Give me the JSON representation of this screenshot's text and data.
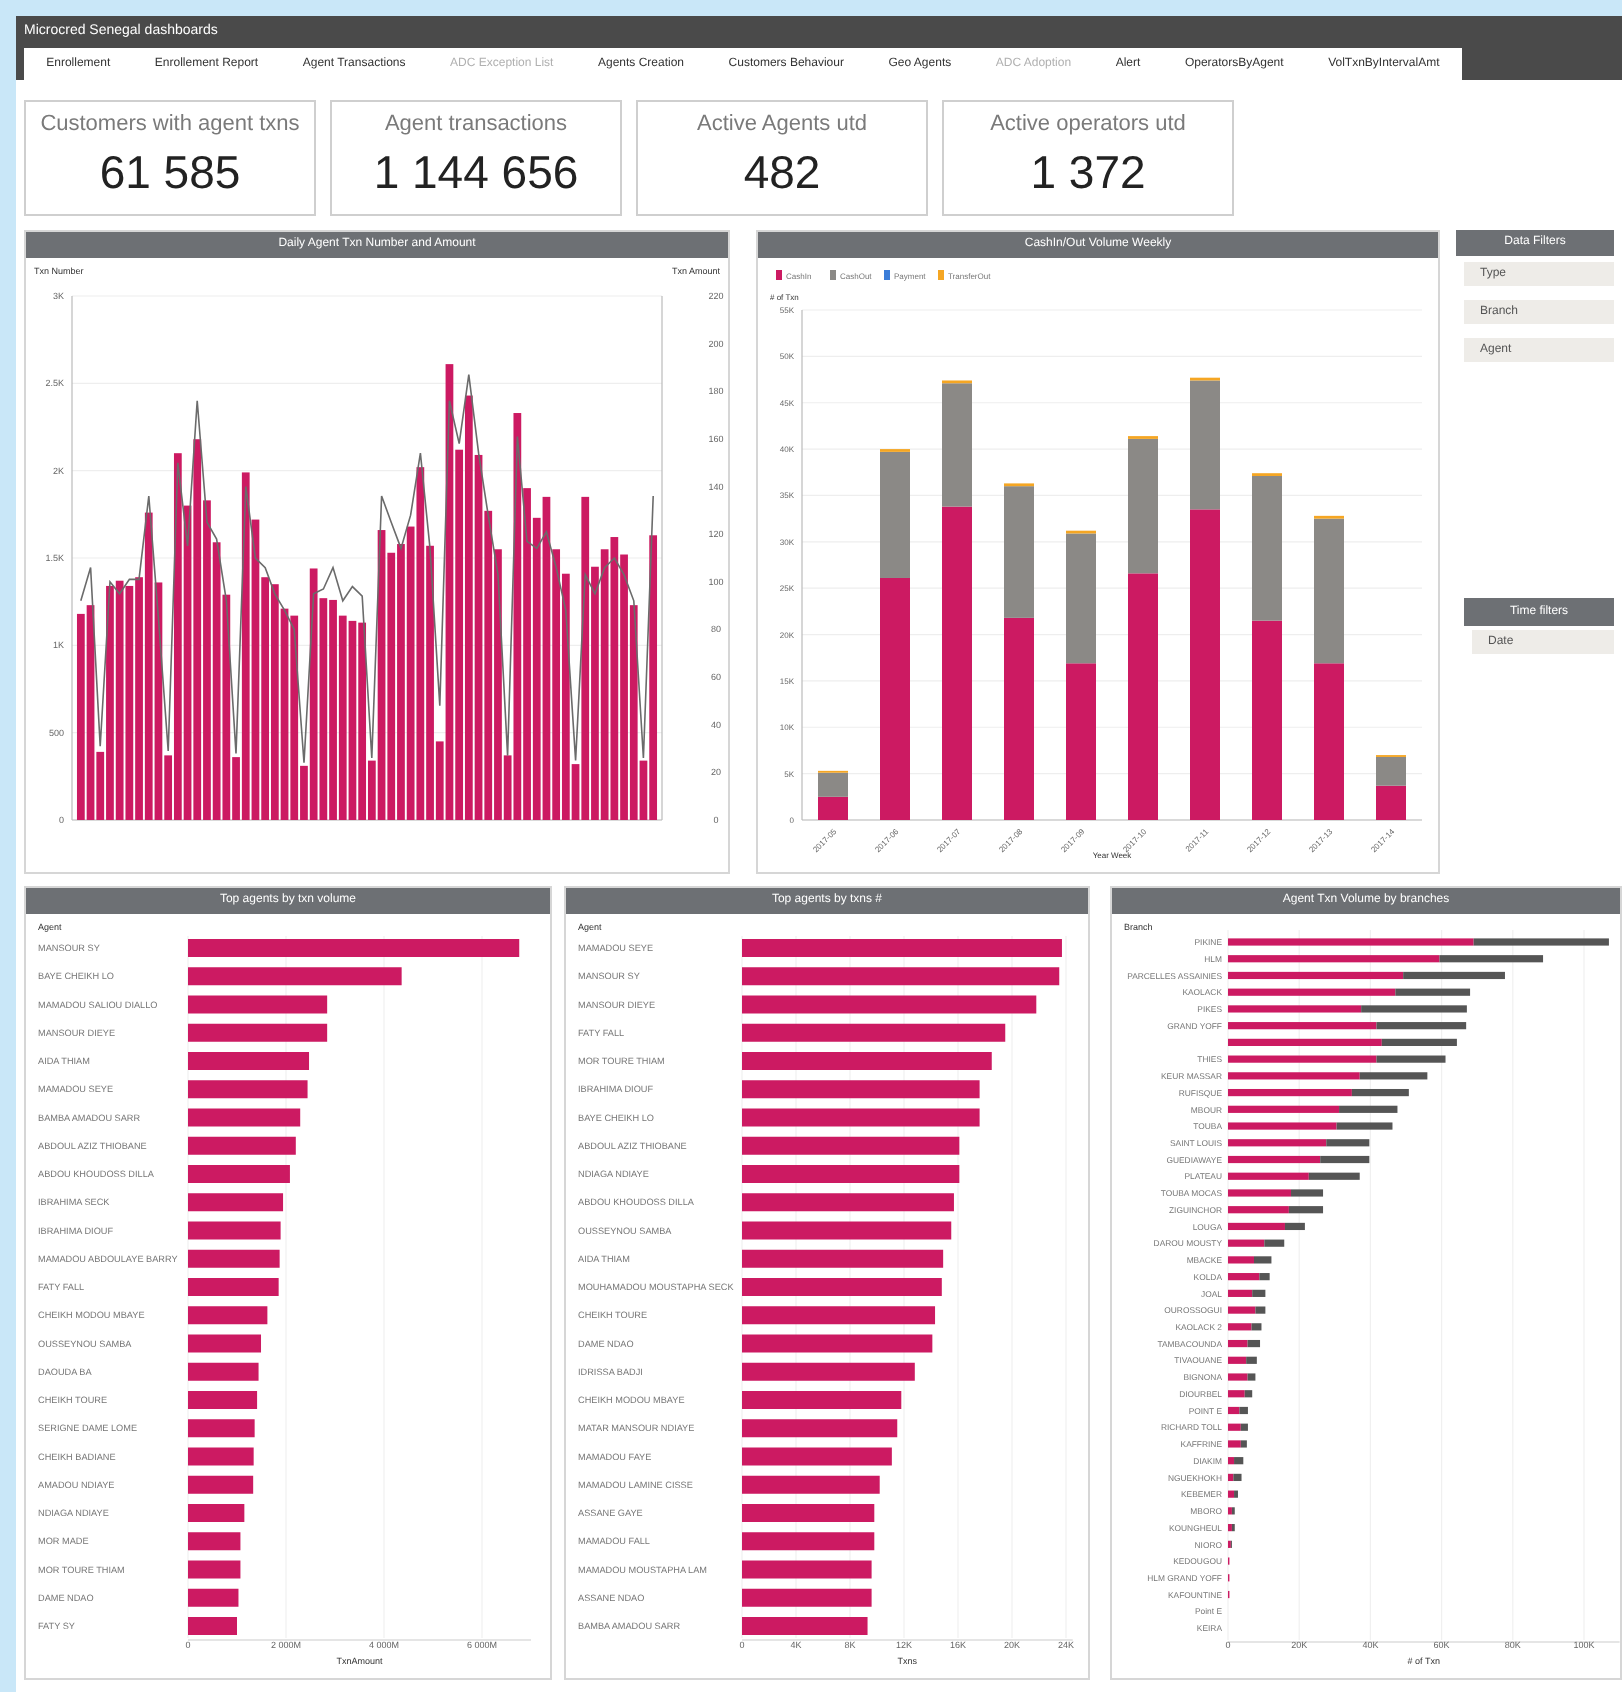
{
  "header": {
    "title": "Microcred Senegal dashboards"
  },
  "tabs": [
    {
      "label": "Enrollement",
      "disabled": false
    },
    {
      "label": "Enrollement Report",
      "disabled": false
    },
    {
      "label": "Agent Transactions",
      "disabled": false
    },
    {
      "label": "ADC Exception List",
      "disabled": true
    },
    {
      "label": "Agents Creation",
      "disabled": false
    },
    {
      "label": "Customers Behaviour",
      "disabled": false
    },
    {
      "label": "Geo Agents",
      "disabled": false
    },
    {
      "label": "ADC Adoption",
      "disabled": true
    },
    {
      "label": "Alert",
      "disabled": false
    },
    {
      "label": "OperatorsByAgent",
      "disabled": false
    },
    {
      "label": "VolTxnByIntervalAmt",
      "disabled": false
    }
  ],
  "kpis": [
    {
      "label": "Customers with agent txns",
      "value": "61 585"
    },
    {
      "label": "Agent transactions",
      "value": "1 144 656"
    },
    {
      "label": "Active Agents utd",
      "value": "482"
    },
    {
      "label": "Active operators utd",
      "value": "1 372"
    }
  ],
  "daily_panel": {
    "title": "Daily Agent Txn Number and Amount",
    "chart_data": {
      "type": "bar",
      "grid": true,
      "ylabel": "Txn Number",
      "y2label": "Txn Amount",
      "ylim": [
        0,
        3000
      ],
      "y2lim": [
        0,
        220
      ],
      "yticks": [
        {
          "value": 0,
          "label": "0"
        },
        {
          "value": 500,
          "label": "500"
        },
        {
          "value": 1000,
          "label": "1K"
        },
        {
          "value": 1500,
          "label": "1.5K"
        },
        {
          "value": 2000,
          "label": "2K"
        },
        {
          "value": 2500,
          "label": "2.5K"
        },
        {
          "value": 3000,
          "label": "3K"
        }
      ],
      "y2ticks": [
        0,
        20,
        40,
        60,
        80,
        100,
        120,
        140,
        160,
        180,
        200,
        220
      ],
      "series": [
        {
          "type": "bar",
          "color": "#cc1a62",
          "values": [
            1180,
            1230,
            390,
            1340,
            1370,
            1340,
            1390,
            1760,
            1360,
            370,
            2100,
            1800,
            2180,
            1830,
            1590,
            1290,
            360,
            1990,
            1720,
            1390,
            1350,
            1210,
            1170,
            310,
            1440,
            1270,
            1260,
            1170,
            1140,
            1130,
            340,
            1660,
            1530,
            1580,
            1680,
            2020,
            1570,
            450,
            2610,
            2120,
            2430,
            2090,
            1770,
            1550,
            370,
            2330,
            1900,
            1730,
            1850,
            1550,
            1410,
            320,
            1850,
            1450,
            1550,
            1620,
            1520,
            1230,
            340,
            1630
          ]
        },
        {
          "type": "line",
          "axis": "y2",
          "color": "#6b6b6b",
          "values": [
            92,
            106,
            31,
            100,
            95,
            101,
            101,
            136,
            85,
            29,
            150,
            115,
            176,
            125,
            118,
            92,
            28,
            140,
            110,
            106,
            95,
            88,
            80,
            24,
            95,
            97,
            106,
            92,
            98,
            94,
            26,
            136,
            125,
            114,
            128,
            154,
            114,
            48,
            176,
            158,
            187,
            154,
            128,
            103,
            27,
            161,
            117,
            114,
            121,
            106,
            88,
            25,
            103,
            95,
            106,
            110,
            103,
            92,
            26,
            136
          ]
        }
      ]
    }
  },
  "weekly_panel": {
    "title": "CashIn/Out Volume Weekly",
    "chart_data": {
      "type": "bar",
      "stacked": true,
      "grid": true,
      "legend": true,
      "ylim": [
        0,
        55000
      ],
      "xlabel": "Year Week",
      "ylabel": "# of Txn",
      "categories": [
        "2017-05",
        "2017-06",
        "2017-07",
        "2017-08",
        "2017-09",
        "2017-10",
        "2017-11",
        "2017-12",
        "2017-13",
        "2017-14"
      ],
      "yticks": [
        {
          "value": 0,
          "label": "0"
        },
        {
          "value": 5000,
          "label": "5K"
        },
        {
          "value": 10000,
          "label": "10K"
        },
        {
          "value": 15000,
          "label": "15K"
        },
        {
          "value": 20000,
          "label": "20K"
        },
        {
          "value": 25000,
          "label": "25K"
        },
        {
          "value": 30000,
          "label": "30K"
        },
        {
          "value": 35000,
          "label": "35K"
        },
        {
          "value": 40000,
          "label": "40K"
        },
        {
          "value": 45000,
          "label": "45K"
        },
        {
          "value": 50000,
          "label": "50K"
        },
        {
          "value": 55000,
          "label": "55K"
        }
      ],
      "series": [
        {
          "name": "CashIn",
          "color": "#cc1a62",
          "values": [
            2500,
            26100,
            33800,
            21800,
            16900,
            26600,
            33500,
            21500,
            16900,
            3700
          ]
        },
        {
          "name": "CashOut",
          "color": "#8b8986",
          "values": [
            2600,
            13600,
            13300,
            14200,
            14000,
            14500,
            13900,
            15600,
            15600,
            3100
          ]
        },
        {
          "name": "Payment",
          "color": "#3b7dd8",
          "values": [
            0,
            0,
            0,
            0,
            0,
            0,
            0,
            0,
            0,
            0
          ]
        },
        {
          "name": "TransferOut",
          "color": "#f5a623",
          "values": [
            200,
            300,
            300,
            300,
            300,
            300,
            300,
            300,
            300,
            200
          ]
        }
      ]
    }
  },
  "filters": {
    "title": "Data Filters",
    "items": [
      "Type",
      "Branch",
      "Agent"
    ]
  },
  "time_filters": {
    "title": "Time filters",
    "items": [
      "Date"
    ]
  },
  "volume_panel": {
    "title": "Top agents by txn volume",
    "chart_data": {
      "type": "bar",
      "orientation": "horizontal",
      "ylabel": "Agent",
      "xlabel": "TxnAmount",
      "grid": true,
      "xlim": [
        0,
        7000
      ],
      "xticks": [
        {
          "value": 0,
          "label": "0"
        },
        {
          "value": 2000,
          "label": "2 000M"
        },
        {
          "value": 4000,
          "label": "4 000M"
        },
        {
          "value": 6000,
          "label": "6 000M"
        }
      ],
      "categories": [
        "MANSOUR SY",
        "BAYE CHEIKH LO",
        "MAMADOU SALIOU DIALLO",
        "MANSOUR DIEYE",
        "AIDA THIAM",
        "MAMADOU SEYE",
        "BAMBA AMADOU SARR",
        "ABDOUL AZIZ THIOBANE",
        "ABDOU KHOUDOSS DILLA",
        "IBRAHIMA SECK",
        "IBRAHIMA DIOUF",
        "MAMADOU ABDOULAYE BARRY",
        "FATY FALL",
        "CHEIKH MODOU MBAYE",
        "OUSSEYNOU SAMBA",
        "DAOUDA BA",
        "CHEIKH TOURE",
        "SERIGNE DAME LOME",
        "CHEIKH BADIANE",
        "AMADOU NDIAYE",
        "NDIAGA NDIAYE",
        "MOR MADE",
        "MOR TOURE THIAM",
        "DAME NDAO",
        "FATY SY"
      ],
      "series": [
        {
          "color": "#cc1a62",
          "values": [
            6760,
            4360,
            2840,
            2840,
            2470,
            2440,
            2290,
            2200,
            2080,
            1940,
            1890,
            1870,
            1850,
            1620,
            1490,
            1440,
            1410,
            1360,
            1340,
            1330,
            1150,
            1070,
            1070,
            1030,
            1000
          ]
        }
      ]
    }
  },
  "count_panel": {
    "title": "Top agents by txns #",
    "chart_data": {
      "type": "bar",
      "orientation": "horizontal",
      "ylabel": "Agent",
      "xlabel": "Txns",
      "grid": true,
      "xlim": [
        0,
        24500
      ],
      "xticks": [
        {
          "value": 0,
          "label": "0"
        },
        {
          "value": 4000,
          "label": "4K"
        },
        {
          "value": 8000,
          "label": "8K"
        },
        {
          "value": 12000,
          "label": "12K"
        },
        {
          "value": 16000,
          "label": "16K"
        },
        {
          "value": 20000,
          "label": "20K"
        },
        {
          "value": 24000,
          "label": "24K"
        }
      ],
      "categories": [
        "MAMADOU SEYE",
        "MANSOUR SY",
        "MANSOUR DIEYE",
        "FATY FALL",
        "MOR TOURE THIAM",
        "IBRAHIMA DIOUF",
        "BAYE CHEIKH LO",
        "ABDOUL AZIZ THIOBANE",
        "NDIAGA NDIAYE",
        "ABDOU KHOUDOSS DILLA",
        "OUSSEYNOU SAMBA",
        "AIDA THIAM",
        "MOUHAMADOU MOUSTAPHA SECK",
        "CHEIKH TOURE",
        "DAME NDAO",
        "IDRISSA BADJI",
        "CHEIKH MODOU MBAYE",
        "MATAR MANSOUR NDIAYE",
        "MAMADOU FAYE",
        "MAMADOU LAMINE CISSE",
        "ASSANE GAYE",
        "MAMADOU FALL",
        "MAMADOU MOUSTAPHA LAM",
        "ASSANE NDAO",
        "BAMBA AMADOU SARR"
      ],
      "series": [
        {
          "color": "#cc1a62",
          "values": [
            23700,
            23500,
            21800,
            19500,
            18500,
            17600,
            17600,
            16100,
            16100,
            15700,
            15500,
            14900,
            14800,
            14300,
            14100,
            12800,
            11800,
            11500,
            11100,
            10200,
            9800,
            9800,
            9600,
            9600,
            9300
          ]
        }
      ]
    }
  },
  "branch_panel": {
    "title": "Agent Txn Volume by branches",
    "chart_data": {
      "type": "bar",
      "orientation": "horizontal",
      "stacked": true,
      "ylabel": "Branch",
      "xlabel": "# of Txn",
      "grid": true,
      "xlim": [
        0,
        110000
      ],
      "xticks": [
        {
          "value": 0,
          "label": "0"
        },
        {
          "value": 20000,
          "label": "20K"
        },
        {
          "value": 40000,
          "label": "40K"
        },
        {
          "value": 60000,
          "label": "60K"
        },
        {
          "value": 80000,
          "label": "80K"
        },
        {
          "value": 100000,
          "label": "100K"
        }
      ],
      "categories": [
        "PIKINE",
        "HLM",
        "PARCELLES ASSAINIES",
        "KAOLACK",
        "PIKES",
        "GRAND YOFF",
        null,
        "THIES",
        "KEUR MASSAR",
        "RUFISQUE",
        "MBOUR",
        "TOUBA",
        "SAINT LOUIS",
        "GUEDIAWAYE",
        "PLATEAU",
        "TOUBA MOCAS",
        "ZIGUINCHOR",
        "LOUGA",
        "DAROU MOUSTY",
        "MBACKE",
        "KOLDA",
        "JOAL",
        "OUROSSOGUI",
        "KAOLACK 2",
        "TAMBACOUNDA",
        "TIVAOUANE",
        "BIGNONA",
        "DIOURBEL",
        "POINT E",
        "RICHARD TOLL",
        "KAFFRINE",
        "DIAKIM",
        "NGUEKHOKH",
        "KEBEMER",
        "MBORO",
        "KOUNGHEUL",
        "NIORO",
        "KEDOUGOU",
        "HLM GRAND YOFF",
        "KAFOUNTINE",
        "Point E",
        "KEIRA"
      ],
      "series": [
        {
          "color": "#cc1a62",
          "values": [
            69000,
            59400,
            49200,
            47000,
            37400,
            41700,
            43200,
            41700,
            37000,
            34800,
            31200,
            30500,
            27600,
            25900,
            22700,
            17700,
            17100,
            16000,
            10200,
            7300,
            8800,
            6800,
            7700,
            6600,
            5500,
            5100,
            5500,
            4700,
            3200,
            3600,
            3600,
            1700,
            1500,
            1700,
            1100,
            1100,
            800,
            400,
            400,
            400,
            0,
            0
          ]
        },
        {
          "color": "#555555",
          "values": [
            38000,
            29100,
            28600,
            21000,
            29700,
            25200,
            21100,
            19400,
            19000,
            16000,
            16400,
            15700,
            12100,
            13800,
            14300,
            9000,
            9600,
            5600,
            5600,
            4900,
            2900,
            3700,
            2800,
            2800,
            3500,
            3000,
            2200,
            2100,
            2400,
            2000,
            1700,
            2600,
            2300,
            1100,
            800,
            800,
            300,
            0,
            0,
            0,
            0,
            0
          ]
        }
      ]
    }
  }
}
